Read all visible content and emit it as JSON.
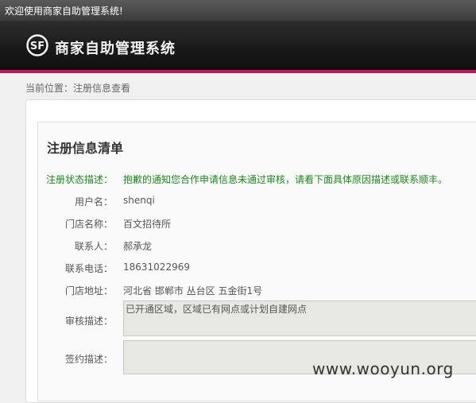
{
  "topbar": {
    "welcome": "欢迎使用商家自助管理系统!"
  },
  "header": {
    "logo_icon": "sf-logo-icon",
    "title": "商家自助管理系统"
  },
  "breadcrumb": "当前位置：注册信息查看",
  "section": {
    "title": "注册信息清单"
  },
  "fields": {
    "status": {
      "label": "注册状态描述：",
      "value": "抱歉的通知您合作申请信息未通过审核，请看下面具体原因描述或联系顺丰。"
    },
    "username": {
      "label": "用户名：",
      "value": "shenqi"
    },
    "store_name": {
      "label": "门店名称：",
      "value": "百文招待所"
    },
    "contact": {
      "label": "联系人：",
      "value": "郝承龙"
    },
    "phone": {
      "label": "联系电话：",
      "value": "18631022969"
    },
    "address": {
      "label": "门店地址：",
      "value": "河北省 邯郸市 丛台区 五金街1号"
    },
    "review": {
      "label": "审核描述：",
      "value": "已开通区域，区域已有网点或计划自建网点"
    },
    "contract": {
      "label": "签约描述：",
      "value": ""
    }
  },
  "watermark": "www.wooyun.org",
  "colors": {
    "accent_red": "#c2185b",
    "status_green": "#1a8a1a"
  }
}
